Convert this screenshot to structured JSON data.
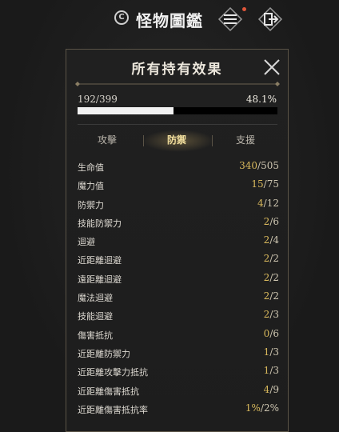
{
  "header": {
    "title": "怪物圖鑑",
    "logo_glyph": "C",
    "icons": [
      "codex-icon",
      "menu-icon",
      "exit-icon"
    ],
    "notification_color": "#e0563a"
  },
  "panel": {
    "title": "所有持有效果",
    "progress": {
      "count": "192/399",
      "percent_label": "48.1%",
      "fraction": 0.481
    },
    "tabs": [
      {
        "label": "攻擊",
        "active": false
      },
      {
        "label": "防禦",
        "active": true
      },
      {
        "label": "支援",
        "active": false
      }
    ],
    "stats": [
      {
        "label": "生命值",
        "current": "340",
        "total": "505"
      },
      {
        "label": "魔力值",
        "current": "15",
        "total": "75"
      },
      {
        "label": "防禦力",
        "current": "4",
        "total": "12"
      },
      {
        "label": "技能防禦力",
        "current": "2",
        "total": "6"
      },
      {
        "label": "迴避",
        "current": "2",
        "total": "4"
      },
      {
        "label": "近距離迴避",
        "current": "2",
        "total": "2"
      },
      {
        "label": "遠距離迴避",
        "current": "2",
        "total": "2"
      },
      {
        "label": "魔法迴避",
        "current": "2",
        "total": "2"
      },
      {
        "label": "技能迴避",
        "current": "2",
        "total": "3"
      },
      {
        "label": "傷害抵抗",
        "current": "0",
        "total": "6"
      },
      {
        "label": "近距離防禦力",
        "current": "1",
        "total": "3"
      },
      {
        "label": "近距離攻擊力抵抗",
        "current": "1",
        "total": "3"
      },
      {
        "label": "近距離傷害抵抗",
        "current": "4",
        "total": "9"
      },
      {
        "label": "近距離傷害抵抗率",
        "current": "1%",
        "total": "2%"
      }
    ],
    "colors": {
      "accent": "#d8b85c",
      "tab_active": "#f0dd9c",
      "border": "#5a5346"
    }
  }
}
